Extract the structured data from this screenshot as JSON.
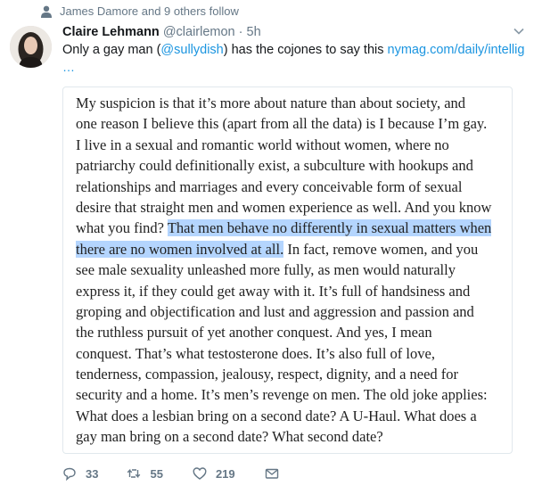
{
  "context": {
    "icon": "person-icon",
    "text": "James Damore and 9 others follow"
  },
  "tweet": {
    "author_name": "Claire Lehmann",
    "handle": "@clairlemon",
    "separator": "·",
    "timestamp": "5h",
    "text_prefix": "Only a gay man (",
    "mention": "@sullydish",
    "text_middle": ") has the cojones to say this ",
    "link_text": "nymag.com/daily/intellig",
    "ellipsis": "…"
  },
  "quote": {
    "lines": [
      {
        "pre": "My suspicion is that it’s more about nature than about society, and"
      },
      {
        "pre": "one reason I believe this (apart from all the data) is I because I’m gay."
      },
      {
        "pre": "I live in a sexual and romantic world without women, where no"
      },
      {
        "pre": "patriarchy could definitionally exist, a subculture with hookups and"
      },
      {
        "pre": "relationships and marriages and every conceivable form of sexual"
      },
      {
        "pre": "desire that straight men and women experience as well. And you know"
      },
      {
        "pre": "what you find? ",
        "hl": "That men behave no differently in sexual matters when"
      },
      {
        "hl": "there are no women involved at all.",
        "post": " In fact, remove women, and you"
      },
      {
        "pre": "see male sexuality unleashed more fully, as men would naturally"
      },
      {
        "pre": "express it, if they could get away with it. It’s full of handsiness and"
      },
      {
        "pre": "groping and objectification and lust and aggression and passion and"
      },
      {
        "pre": "the ruthless pursuit of yet another conquest. And yes, I mean"
      },
      {
        "pre": "conquest. That’s what testosterone does. It’s also full of love,"
      },
      {
        "pre": "tenderness, compassion, jealousy, respect, dignity, and a need for"
      },
      {
        "pre": "security and a home. It’s men’s revenge on men. The old joke applies:"
      },
      {
        "pre": "What does a lesbian bring on a second date? A U-Haul. What does a"
      },
      {
        "pre": "gay man bring on a second date? What second date?"
      }
    ]
  },
  "actions": {
    "reply_icon": "reply-icon",
    "reply_count": "33",
    "retweet_icon": "retweet-icon",
    "retweet_count": "55",
    "like_icon": "heart-icon",
    "like_count": "219",
    "dm_icon": "envelope-icon"
  },
  "colors": {
    "link": "#1b95e0",
    "muted": "#657786",
    "highlight": "#b4d5fe",
    "text": "#14171a"
  }
}
